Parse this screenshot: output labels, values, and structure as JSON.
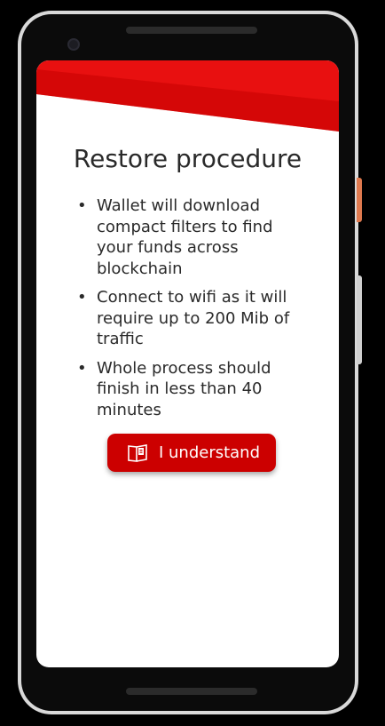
{
  "app": {
    "title": "Restore procedure",
    "bullets": [
      "Wallet will download compact filters to find your funds across blockchain",
      "Connect to wifi as it will require up to 200 Mib of traffic",
      "Whole process should finish in less than 40 minutes"
    ],
    "bullet_symbol": "•",
    "button": {
      "label": "I understand",
      "icon": "book-icon"
    },
    "colors": {
      "accent": "#cc0000",
      "banner_light": "#e81010",
      "banner_dark": "#c40000",
      "text": "#2a2a2a",
      "screen_bg": "#ffffff"
    }
  }
}
